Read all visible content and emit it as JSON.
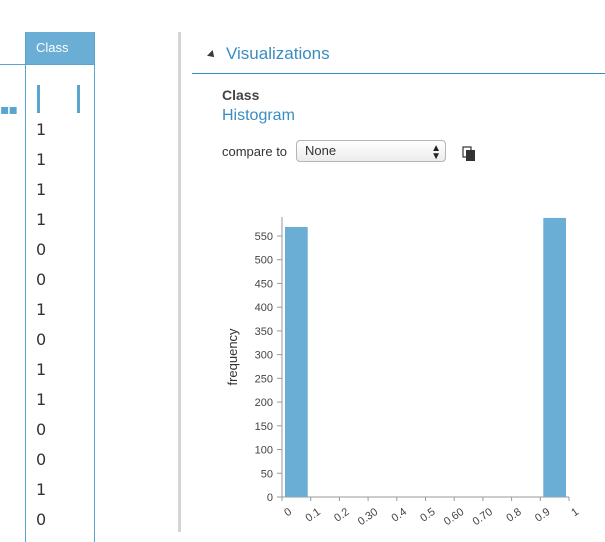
{
  "class_column": {
    "header": "Class",
    "values": [
      "1",
      "1",
      "1",
      "1",
      "0",
      "0",
      "1",
      "0",
      "1",
      "1",
      "0",
      "0",
      "1",
      "0"
    ]
  },
  "visualizations": {
    "title": "Visualizations",
    "column_name": "Class",
    "chart_type_label": "Histogram",
    "compare_label": "compare to",
    "compare_selected": "None"
  },
  "icons": {
    "collapse": "collapse-triangle-icon",
    "copy": "copy-icon",
    "select_arrows": "updown-arrows-icon"
  },
  "colors": {
    "accent": "#3a8dc1",
    "bar": "#6aaed5"
  },
  "chart_data": {
    "type": "bar",
    "ylabel": "frequency",
    "xlabel": "",
    "x_ticks": [
      "0",
      "0.1",
      "0.2",
      "0.30",
      "0.4",
      "0.5",
      "0.60",
      "0.70",
      "0.8",
      "0.9",
      "1"
    ],
    "y_ticks": [
      0,
      50,
      100,
      150,
      200,
      250,
      300,
      350,
      400,
      450,
      500,
      550
    ],
    "ylim": [
      0,
      590
    ],
    "bins": [
      {
        "start": 0,
        "end": 0.1,
        "count": 569
      },
      {
        "start": 0.9,
        "end": 1.0,
        "count": 588
      }
    ]
  }
}
